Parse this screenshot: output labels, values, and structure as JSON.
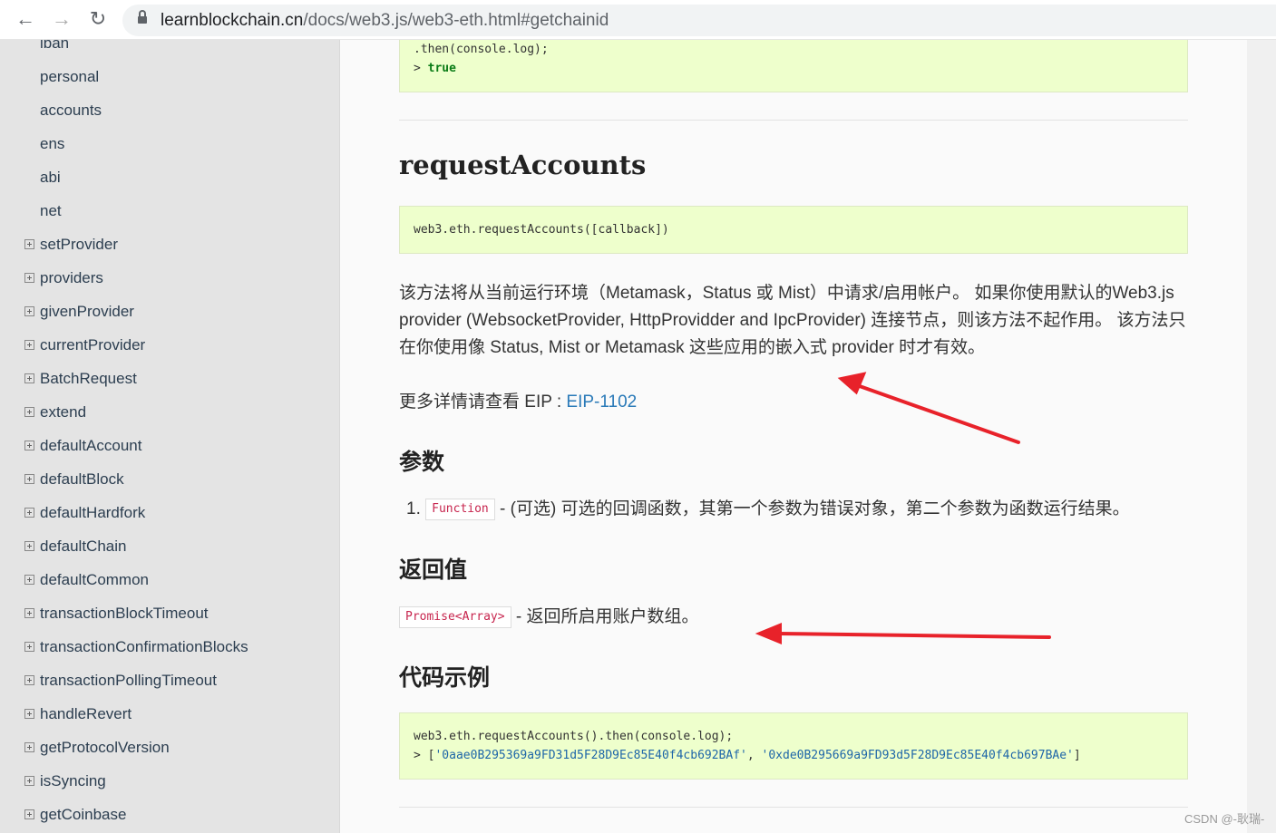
{
  "browser": {
    "url_host": "learnblockchain.cn",
    "url_path": "/docs/web3.js/web3-eth.html#getchainid",
    "back": "←",
    "forward": "→",
    "reload": "↻"
  },
  "sidebar": {
    "items": [
      {
        "label": "iban",
        "expandable": false
      },
      {
        "label": "personal",
        "expandable": false
      },
      {
        "label": "accounts",
        "expandable": false
      },
      {
        "label": "ens",
        "expandable": false
      },
      {
        "label": "abi",
        "expandable": false
      },
      {
        "label": "net",
        "expandable": false
      },
      {
        "label": "setProvider",
        "expandable": true
      },
      {
        "label": "providers",
        "expandable": true
      },
      {
        "label": "givenProvider",
        "expandable": true
      },
      {
        "label": "currentProvider",
        "expandable": true
      },
      {
        "label": "BatchRequest",
        "expandable": true
      },
      {
        "label": "extend",
        "expandable": true
      },
      {
        "label": "defaultAccount",
        "expandable": true
      },
      {
        "label": "defaultBlock",
        "expandable": true
      },
      {
        "label": "defaultHardfork",
        "expandable": true
      },
      {
        "label": "defaultChain",
        "expandable": true
      },
      {
        "label": "defaultCommon",
        "expandable": true
      },
      {
        "label": "transactionBlockTimeout",
        "expandable": true
      },
      {
        "label": "transactionConfirmationBlocks",
        "expandable": true
      },
      {
        "label": "transactionPollingTimeout",
        "expandable": true
      },
      {
        "label": "handleRevert",
        "expandable": true
      },
      {
        "label": "getProtocolVersion",
        "expandable": true
      },
      {
        "label": "isSyncing",
        "expandable": true
      },
      {
        "label": "getCoinbase",
        "expandable": true
      }
    ]
  },
  "main": {
    "prev_code": {
      "line1": ".then(console.log);",
      "prompt": "> ",
      "result": "true"
    },
    "title": "requestAccounts",
    "signature": "web3.eth.requestAccounts([callback])",
    "description": "该方法将从当前运行环境（Metamask，Status 或 Mist）中请求/启用帐户。 如果你使用默认的Web3.js provider (WebsocketProvider, HttpProvidder and IpcProvider) 连接节点，则该方法不起作用。 该方法只在你使用像 Status, Mist or Metamask 这些应用的嵌入式 provider 时才有效。",
    "more_prefix": "更多详情请查看 EIP : ",
    "more_link": "EIP-1102",
    "params_heading": "参数",
    "params": [
      {
        "num": "1.",
        "type": "Function",
        "desc": " - (可选) 可选的回调函数，其第一个参数为错误对象，第二个参数为函数运行结果。"
      }
    ],
    "returns_heading": "返回值",
    "returns": {
      "type": "Promise<Array>",
      "desc": " - 返回所启用账户数组。"
    },
    "example_heading": "代码示例",
    "example": {
      "line1": "web3.eth.requestAccounts().then(console.log);",
      "prompt": "> [",
      "addr1": "'0aae0B295369a9FD31d5F28D9Ec85E40f4cb692BAf'",
      "sep": ", ",
      "addr2": "'0xde0B295669a9FD93d5F28D9Ec85E40f4cb697BAe'",
      "end": "]"
    }
  },
  "watermark": "CSDN @-耿瑞-",
  "colors": {
    "annotation_arrow": "#e8222a",
    "code_bg": "#eeffcc",
    "link": "#2a7ab8"
  }
}
